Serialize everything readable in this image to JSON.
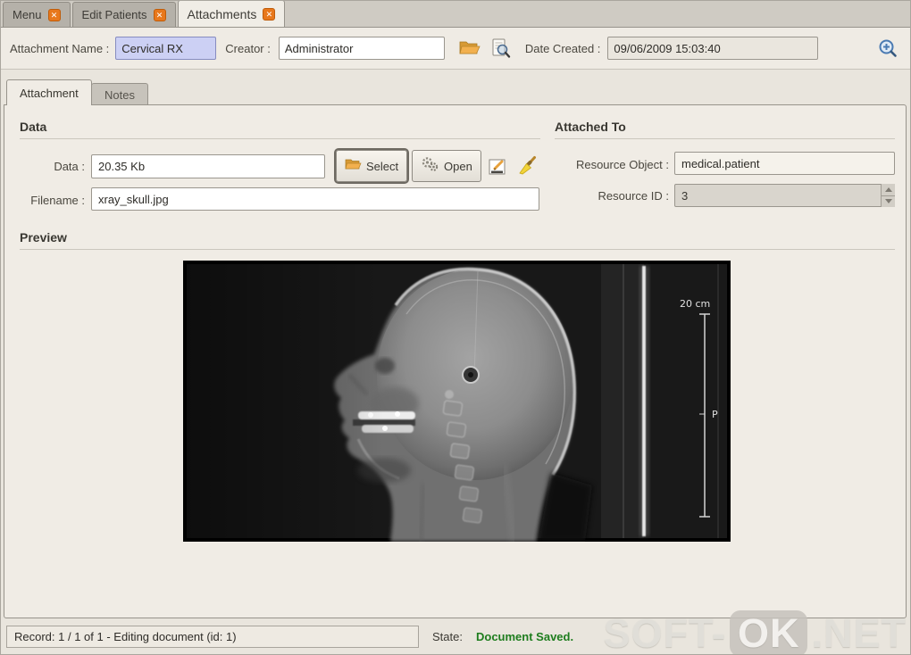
{
  "window_tabs": {
    "items": [
      {
        "label": "Menu"
      },
      {
        "label": "Edit Patients"
      },
      {
        "label": "Attachments"
      }
    ],
    "close_glyph": "✕"
  },
  "toolbar": {
    "attachment_name_label": "Attachment Name :",
    "attachment_name_value": "Cervical RX",
    "creator_label": "Creator :",
    "creator_value": "Administrator",
    "date_created_label": "Date Created :",
    "date_created_value": "09/06/2009 15:03:40"
  },
  "notebook_tabs": [
    {
      "label": "Attachment"
    },
    {
      "label": "Notes"
    }
  ],
  "data_section": {
    "title": "Data",
    "data_label": "Data :",
    "data_value": "20.35 Kb",
    "select_button_label": "Select",
    "open_button_label": "Open",
    "filename_label": "Filename :",
    "filename_value": "xray_skull.jpg"
  },
  "attached_to_section": {
    "title": "Attached To",
    "resource_object_label": "Resource Object :",
    "resource_object_value": "medical.patient",
    "resource_id_label": "Resource ID :",
    "resource_id_value": "3"
  },
  "preview_section": {
    "title": "Preview",
    "xray": {
      "scale_label": "20 cm",
      "posterior_label": "P"
    }
  },
  "status_bar": {
    "record_text": "Record: 1 / 1 of 1 - Editing document (id: 1)",
    "state_label": "State:",
    "state_value": "Document Saved."
  },
  "watermark": {
    "part1": "SOFT-",
    "part2": "OK",
    "part3": ".NET"
  },
  "colors": {
    "accent_orange": "#e8781c",
    "state_green": "#1e7d1e",
    "name_field_bg": "#ccd0f4",
    "panel_bg": "#f0ece5"
  }
}
